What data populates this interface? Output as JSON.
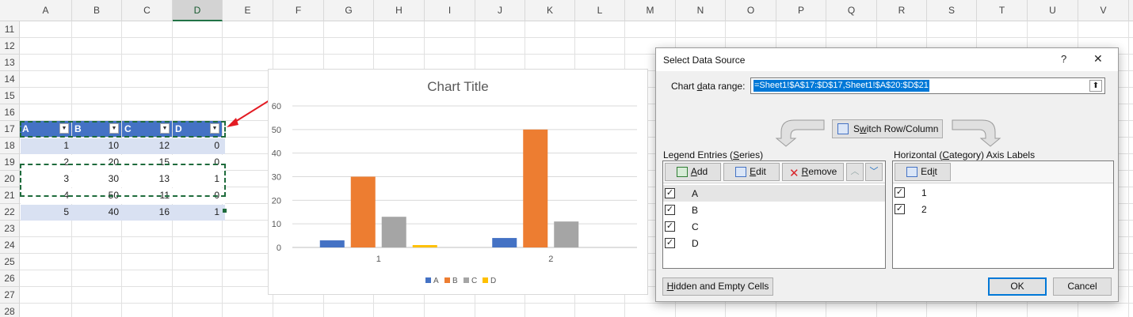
{
  "sheet": {
    "columns": [
      "A",
      "B",
      "C",
      "D",
      "E",
      "F",
      "G",
      "H",
      "I",
      "J",
      "K",
      "L",
      "M",
      "N",
      "O",
      "P",
      "Q",
      "R",
      "S",
      "T",
      "U",
      "V"
    ],
    "selected_column": "D",
    "rows": [
      "11",
      "12",
      "13",
      "14",
      "15",
      "16",
      "17",
      "18",
      "19",
      "20",
      "21",
      "22",
      "23",
      "24",
      "25",
      "26",
      "27",
      "28"
    ],
    "table": {
      "headers": [
        "A",
        "B",
        "C",
        "D"
      ],
      "data": [
        [
          "1",
          "10",
          "12",
          "0"
        ],
        [
          "2",
          "20",
          "15",
          "0"
        ],
        [
          "3",
          "30",
          "13",
          "1"
        ],
        [
          "4",
          "50",
          "11",
          "0"
        ],
        [
          "5",
          "40",
          "16",
          "1"
        ]
      ]
    }
  },
  "chart": {
    "title": "Chart Title",
    "chart_data": {
      "type": "bar",
      "title": "Chart Title",
      "categories": [
        "1",
        "2"
      ],
      "series": [
        {
          "name": "A",
          "values": [
            3,
            4
          ],
          "color": "#4472c4"
        },
        {
          "name": "B",
          "values": [
            30,
            50
          ],
          "color": "#ed7d31"
        },
        {
          "name": "C",
          "values": [
            13,
            11
          ],
          "color": "#a5a5a5"
        },
        {
          "name": "D",
          "values": [
            1,
            0
          ],
          "color": "#ffc000"
        }
      ],
      "yticks": [
        "0",
        "10",
        "20",
        "30",
        "40",
        "50",
        "60"
      ],
      "ylim": [
        0,
        60
      ],
      "grid": true,
      "legend": "bottom"
    }
  },
  "dialog": {
    "title": "Select Data Source",
    "help": "?",
    "close": "✕",
    "range_label_pre": "Chart ",
    "range_label_u": "d",
    "range_label_post": "ata range:",
    "range_value": "=Sheet1!$A$17:$D$17,Sheet1!$A$20:$D$21",
    "collapse_icon": "⬆",
    "switch_pre": "S",
    "switch_u": "w",
    "switch_post": "itch Row/Column",
    "legend_title_pre": "Legend Entries (",
    "legend_title_u": "S",
    "legend_title_post": "eries)",
    "axis_title_pre": "Horizontal (",
    "axis_title_u": "C",
    "axis_title_post": "ategory) Axis Labels",
    "add_pre": "",
    "add_u": "A",
    "add_post": "dd",
    "edit_pre": "",
    "edit_u": "E",
    "edit_post": "dit",
    "remove_pre": "",
    "remove_u": "R",
    "remove_post": "emove",
    "axis_edit_pre": "Ed",
    "axis_edit_u": "i",
    "axis_edit_post": "t",
    "series": [
      "A",
      "B",
      "C",
      "D"
    ],
    "axis_labels": [
      "1",
      "2"
    ],
    "check_mark": "✓",
    "hidden_pre": "",
    "hidden_u": "H",
    "hidden_post": "idden and Empty Cells",
    "ok": "OK",
    "cancel": "Cancel"
  }
}
